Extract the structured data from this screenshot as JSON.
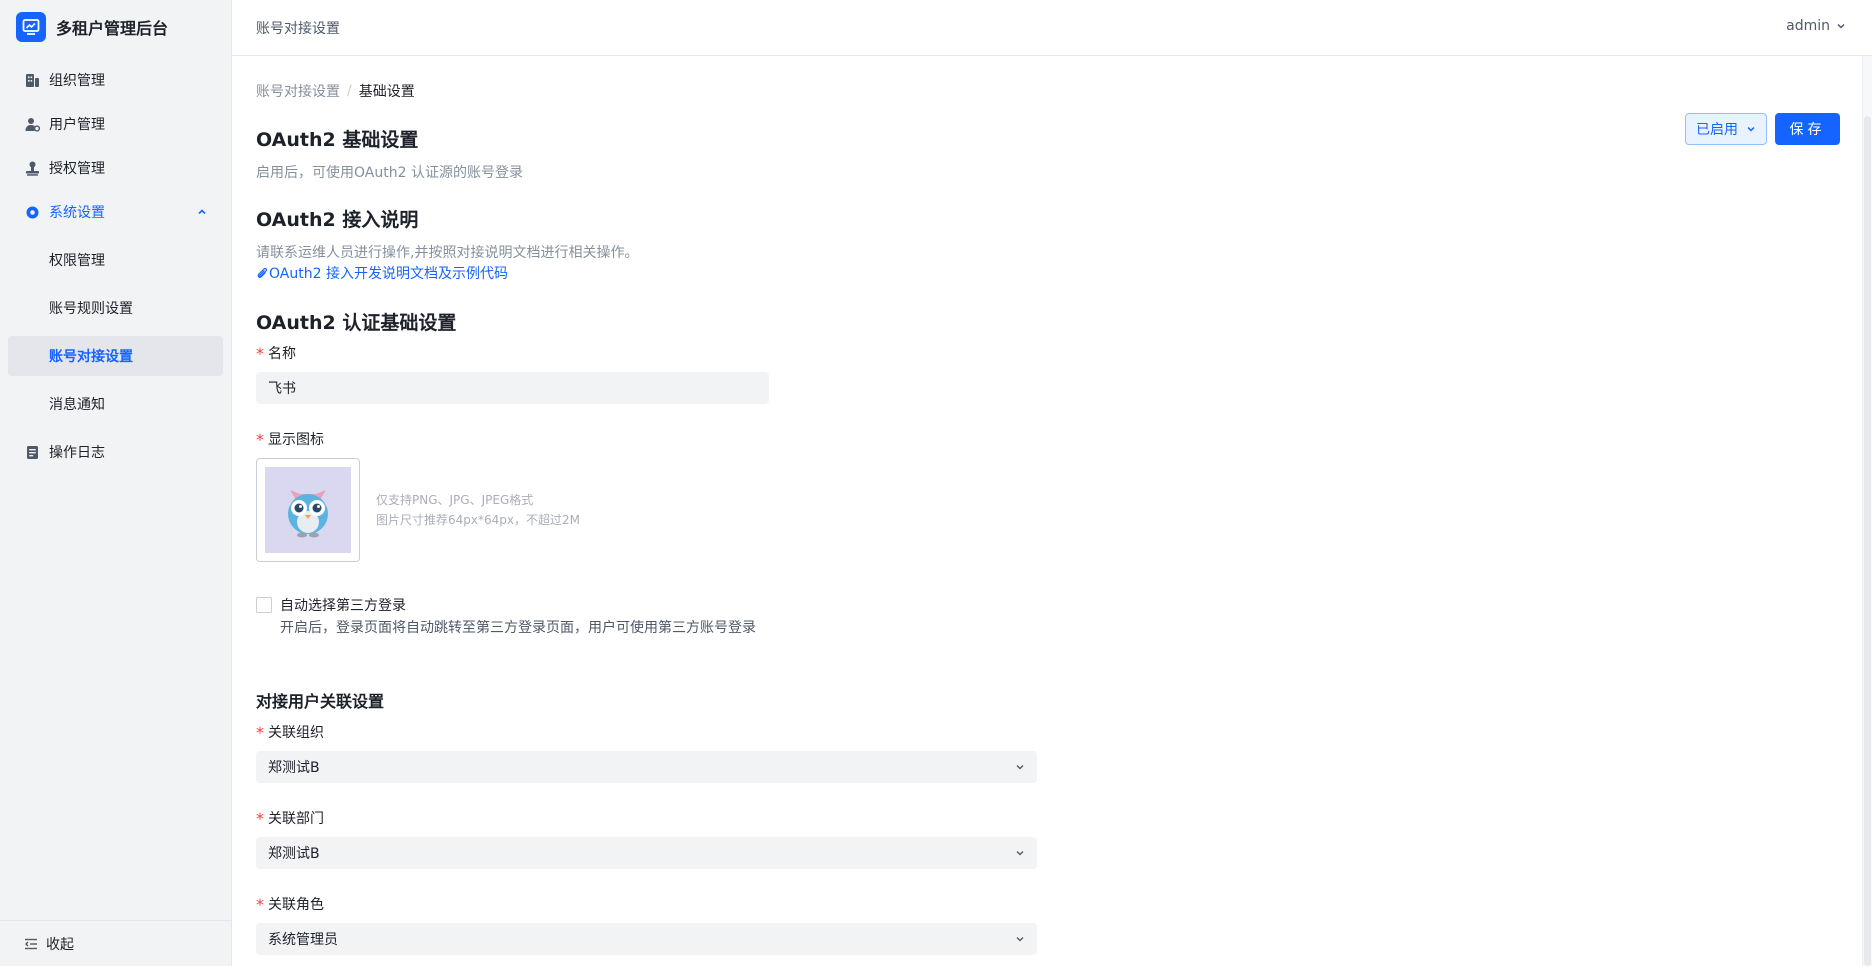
{
  "app": {
    "name": "多租户管理后台"
  },
  "header": {
    "title": "账号对接设置",
    "user": "admin"
  },
  "sidebar": {
    "items": [
      {
        "label": "组织管理"
      },
      {
        "label": "用户管理"
      },
      {
        "label": "授权管理"
      },
      {
        "label": "系统设置"
      },
      {
        "label": "操作日志"
      }
    ],
    "subitems": [
      {
        "label": "权限管理"
      },
      {
        "label": "账号规则设置"
      },
      {
        "label": "账号对接设置"
      },
      {
        "label": "消息通知"
      }
    ],
    "collapse_label": "收起"
  },
  "breadcrumb": {
    "parent": "账号对接设置",
    "separator": "/",
    "current": "基础设置"
  },
  "actions": {
    "status": "已启用",
    "save": "保存"
  },
  "basic": {
    "title": "OAuth2 基础设置",
    "desc": "启用后，可使用OAuth2 认证源的账号登录"
  },
  "guide": {
    "title": "OAuth2 接入说明",
    "desc": "请联系运维人员进行操作,并按照对接说明文档进行相关操作。",
    "link": "OAuth2 接入开发说明文档及示例代码"
  },
  "auth": {
    "title": "OAuth2 认证基础设置",
    "name_label": "名称",
    "name_value": "飞书",
    "icon_label": "显示图标",
    "icon_hint_1": "仅支持PNG、JPG、JPEG格式",
    "icon_hint_2": "图片尺寸推荐64px*64px，不超过2M",
    "auto_label": "自动选择第三方登录",
    "auto_desc": "开启后，登录页面将自动跳转至第三方登录页面，用户可使用第三方账号登录"
  },
  "mapping": {
    "title": "对接用户关联设置",
    "org_label": "关联组织",
    "org_value": "郑测试B",
    "dept_label": "关联部门",
    "dept_value": "郑测试B",
    "role_label": "关联角色",
    "role_value": "系统管理员"
  },
  "colors": {
    "primary": "#1664ff",
    "required": "#f53f3f",
    "sidebar_bg": "#f2f3f5"
  }
}
